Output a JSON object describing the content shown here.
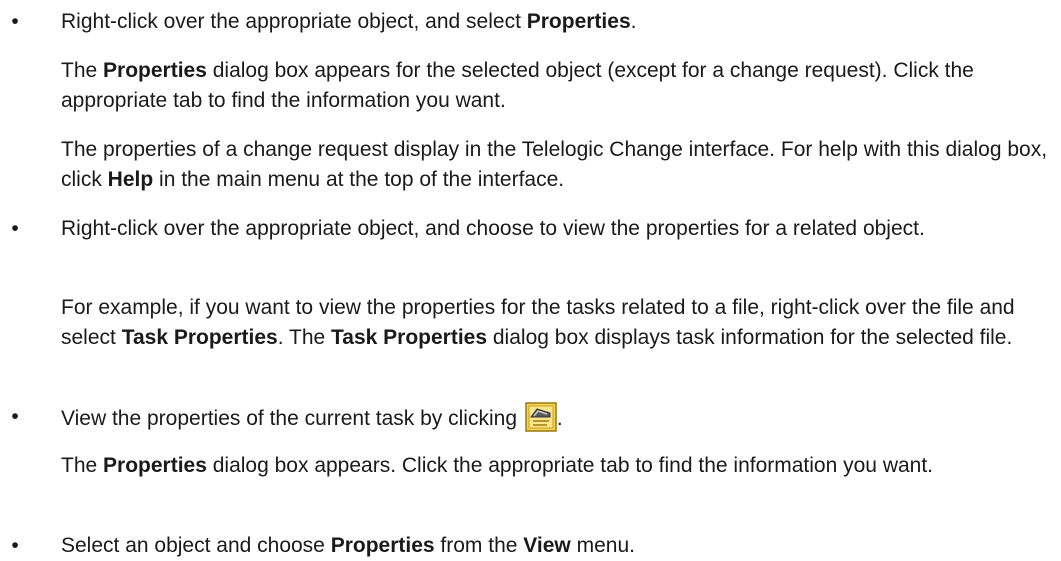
{
  "items": [
    {
      "bullet": "•",
      "lead": {
        "pre": "Right-click over the appropriate object, and select ",
        "bold": "Properties",
        "post": "."
      },
      "p1": {
        "pre": "The ",
        "bold": "Properties",
        "post": " dialog box appears for the selected object (except for a change request). Click the appropriate tab to find the information you want."
      },
      "p2": {
        "pre": "The properties of a change request display in the Telelogic Change interface. For help with this dialog box, click ",
        "bold": "Help",
        "post": " in the main menu at the top of the interface."
      }
    },
    {
      "bullet": "•",
      "lead": "Right-click over the appropriate object, and choose to view the properties for a related object.",
      "p1": {
        "pre": "For example, if you want to view the properties for the tasks related to a file, right-click over the file and select ",
        "bold1": "Task Properties",
        "mid": ". The ",
        "bold2": "Task Properties",
        "post": " dialog box displays task information for the selected file."
      }
    },
    {
      "bullet": "•",
      "lead": {
        "pre": "View the properties of the current task by clicking ",
        "icon": "task-properties-icon",
        "post": "."
      },
      "p1": {
        "pre": "The ",
        "bold": "Properties",
        "post": " dialog box appears. Click the appropriate tab to find the information you want."
      }
    },
    {
      "bullet": "•",
      "lead": {
        "pre": "Select an object and choose ",
        "bold1": "Properties",
        "mid": " from the ",
        "bold2": "View",
        "post": " menu."
      }
    }
  ]
}
